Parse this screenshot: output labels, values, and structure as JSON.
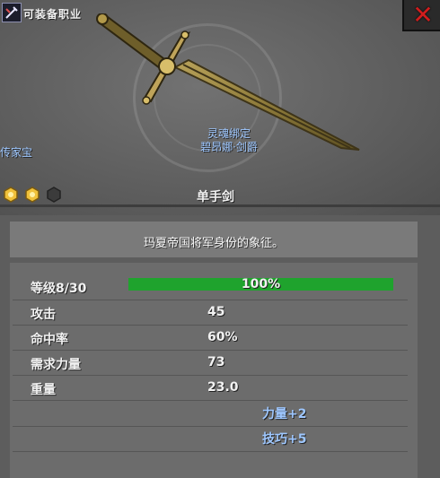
{
  "header": {
    "equip_label": "可装备职业",
    "close_icon": "x-icon"
  },
  "item": {
    "bound": "灵魂绑定",
    "owner": "碧昂娜·剑爵",
    "rarity": "传家宝",
    "type": "单手剑",
    "description": "玛夏帝国将军身份的象征。",
    "gems": [
      "gold-gem",
      "gold-gem",
      "empty-gem"
    ]
  },
  "stats": {
    "level": {
      "label": "等级8/30",
      "percent_text": "100%",
      "fill": 1.0
    },
    "rows": [
      {
        "label": "攻击",
        "value": "45"
      },
      {
        "label": "命中率",
        "value": "60%"
      },
      {
        "label": "需求力量",
        "value": "73"
      },
      {
        "label": "重量",
        "value": "23.0"
      }
    ],
    "bonuses": [
      "力量+2",
      "技巧+5"
    ]
  },
  "colors": {
    "accent_blue": "#9ec7ff",
    "level_green": "#1fa32d",
    "close_red": "#d11d1d"
  }
}
